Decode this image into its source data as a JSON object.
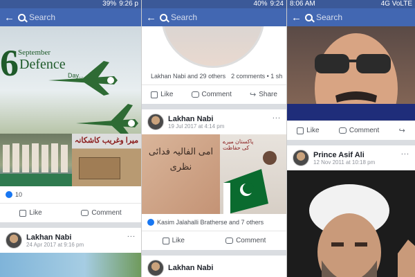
{
  "panel1": {
    "status": {
      "battery": "39%",
      "time": "9:26 p"
    },
    "search_placeholder": "Search",
    "banner": {
      "number": "6",
      "month": "September",
      "title": "Defence",
      "sub": "Day..."
    },
    "image_caption": "میرا وغریب کاشکانہ",
    "reaction_count": "10",
    "actions": {
      "like": "Like",
      "comment": "Comment"
    },
    "post": {
      "author": "Lakhan Nabi",
      "date": "24 Apr 2017 at 9:16 pm",
      "more": "..."
    }
  },
  "panel2": {
    "status": {
      "battery": "40%",
      "time": "9:24"
    },
    "search_placeholder": "Search",
    "reactions": "Lakhan Nabi and 29 others",
    "comments": "2 comments • 1 sh",
    "actions": {
      "like": "Like",
      "comment": "Comment",
      "share": "Share"
    },
    "post": {
      "author": "Lakhan Nabi",
      "date": "19 Jul 2017 at 4:14 pm",
      "more": "..."
    },
    "image_text_left": "امی الفالیہ فدائی نظری",
    "image_text_right": "پاکستان میرے کی حفاظت",
    "reactions2": "Kasim Jalahalli Bratherse and 7 others",
    "actions2": {
      "like": "Like",
      "comment": "Comment"
    },
    "post2": {
      "author": "Lakhan Nabi"
    }
  },
  "panel3": {
    "status": {
      "time": "8:06 AM",
      "network": "4G VoLTE"
    },
    "search_placeholder": "Search",
    "actions": {
      "like": "Like",
      "comment": "Comment"
    },
    "post": {
      "author": "Prince Asif Ali",
      "date": "12 Nov 2011 at 10:18 pm",
      "more": "..."
    }
  }
}
